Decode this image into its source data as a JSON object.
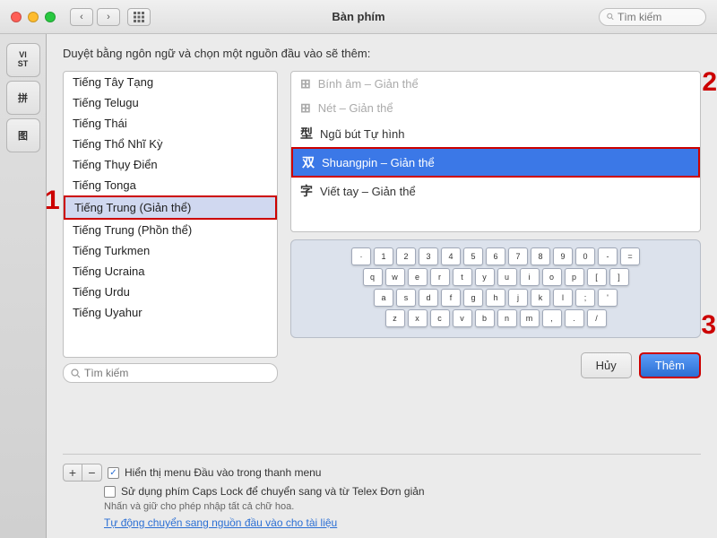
{
  "titlebar": {
    "title": "Bàn phím",
    "search_placeholder": "Tìm kiếm"
  },
  "nav": {
    "back_label": "‹",
    "forward_label": "›",
    "grid_label": "⊞"
  },
  "sidebar": {
    "items": [
      {
        "label": "VI\nST",
        "id": "vi-st"
      },
      {
        "label": "拼",
        "id": "pin"
      },
      {
        "label": "图",
        "id": "tu"
      }
    ]
  },
  "instruction": "Duyệt bằng ngôn ngữ và chọn một nguồn đầu vào sẽ thêm:",
  "languages": [
    "Tiếng Tây Tạng",
    "Tiếng Telugu",
    "Tiếng Thái",
    "Tiếng Thổ Nhĩ Kỳ",
    "Tiếng Thụy Điển",
    "Tiếng Tonga",
    "Tiếng Trung (Giản thể)",
    "Tiếng Trung (Phồn thể)",
    "Tiếng Turkmen",
    "Tiếng Ucraina",
    "Tiếng Urdu",
    "Tiếng Uyahur"
  ],
  "selected_language": "Tiếng Trung (Giản thể)",
  "input_methods": [
    {
      "icon": "⊞",
      "label": "Bính âm – Giản thể",
      "disabled": true
    },
    {
      "icon": "⊞",
      "label": "Nét – Giản thể",
      "disabled": true
    },
    {
      "icon": "型",
      "label": "Ngũ bút Tự hình",
      "disabled": false
    },
    {
      "icon": "双",
      "label": "Shuangpin – Giản thể",
      "selected": true
    },
    {
      "icon": "字",
      "label": "Viết tay – Giản thể",
      "disabled": false
    }
  ],
  "keyboard": {
    "rows": [
      [
        "·",
        "1",
        "2",
        "3",
        "4",
        "5",
        "6",
        "7",
        "8",
        "9",
        "0",
        "-",
        "="
      ],
      [
        "q",
        "w",
        "e",
        "r",
        "t",
        "y",
        "u",
        "i",
        "o",
        "p",
        "[",
        "]"
      ],
      [
        "a",
        "s",
        "d",
        "f",
        "g",
        "h",
        "j",
        "k",
        "l",
        ";",
        "'"
      ],
      [
        "z",
        "x",
        "c",
        "v",
        "b",
        "n",
        "m",
        ",",
        ".",
        "/"
      ]
    ]
  },
  "buttons": {
    "cancel": "Hủy",
    "add": "Thêm"
  },
  "footer": {
    "checkbox1_label": "Hiển thị menu Đầu vào trong thanh menu",
    "checkbox1_checked": true,
    "checkbox2_label": "Sử dụng phím Caps Lock để chuyển sang và từ Telex Đơn giản",
    "checkbox2_checked": false,
    "note": "Nhấn và giữ cho phép nhập tất cả chữ hoa.",
    "link": "Tự động chuyển sang nguồn đầu vào cho tài liệu"
  },
  "markers": {
    "one": "1",
    "two": "2",
    "three": "3"
  },
  "search_list_placeholder": "Tìm kiếm"
}
